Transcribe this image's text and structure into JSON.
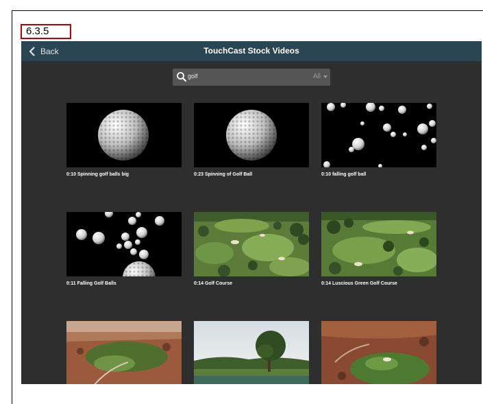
{
  "step_label": "6.3.5",
  "nav": {
    "back_label": "Back",
    "title": "TouchCast Stock Videos"
  },
  "search": {
    "query": "golf",
    "filter_value": "All"
  },
  "videos": [
    {
      "duration": "0:10",
      "title": "Spinning golf balls big"
    },
    {
      "duration": "0:23",
      "title": "Spinning of Golf Ball"
    },
    {
      "duration": "0:10",
      "title": "falling golf ball"
    },
    {
      "duration": "0:11",
      "title": "Falling Golf Balls"
    },
    {
      "duration": "0:14",
      "title": "Golf Course"
    },
    {
      "duration": "0:14",
      "title": "Luscious Green Golf Course"
    },
    {
      "duration": "",
      "title": ""
    },
    {
      "duration": "",
      "title": ""
    },
    {
      "duration": "",
      "title": ""
    }
  ],
  "colors": {
    "navbar": "#2a4652",
    "background": "#2e2e2e",
    "step_border": "#c00000"
  }
}
